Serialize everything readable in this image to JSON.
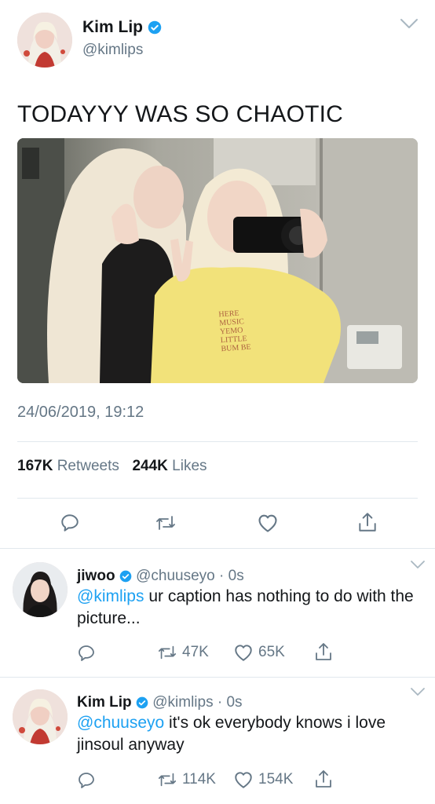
{
  "main_tweet": {
    "name": "Kim Lip",
    "handle": "@kimlips",
    "text": "TODAYYY WAS SO CHAOTIC",
    "timestamp": "24/06/2019, 19:12",
    "retweets_count": "167K",
    "retweets_label": "Retweets",
    "likes_count": "244K",
    "likes_label": "Likes",
    "photo_shirt_text": [
      "HERE",
      "MUSIC",
      "YEMO",
      "LITTLE",
      "BUM BE"
    ]
  },
  "replies": [
    {
      "name": "jiwoo",
      "handle": "@chuuseyo",
      "time": "0s",
      "mention": "@kimlips",
      "text": " ur caption has nothing to do with the picture...",
      "retweets": "47K",
      "likes": "65K"
    },
    {
      "name": "Kim Lip",
      "handle": "@kimlips",
      "time": "0s",
      "mention": "@chuuseyo",
      "text": " it's ok everybody knows i love jinsoul anyway",
      "retweets": "114K",
      "likes": "154K"
    }
  ],
  "separator": "·",
  "colors": {
    "accent": "#1da1f2",
    "muted": "#657786",
    "divider": "#e1e8ed",
    "text": "#14171a"
  },
  "icons": [
    "verified-badge-icon",
    "chevron-down-icon",
    "reply-icon",
    "retweet-icon",
    "like-icon",
    "share-icon"
  ]
}
